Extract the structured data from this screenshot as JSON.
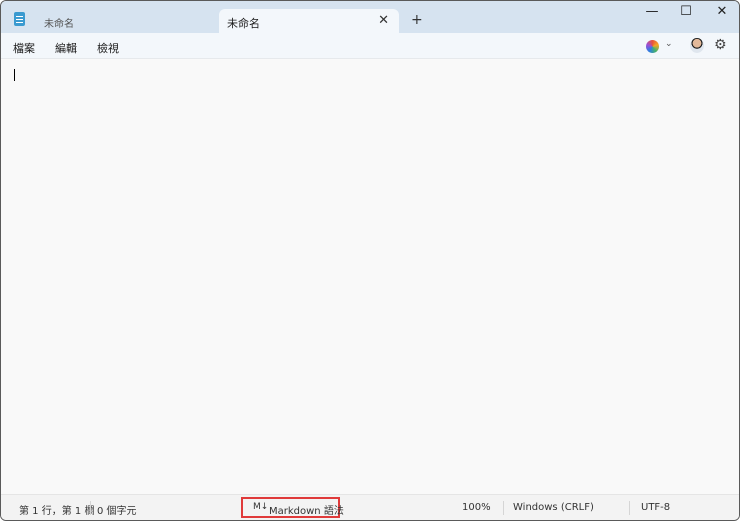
{
  "tabs": [
    {
      "label": "未命名",
      "active": false
    },
    {
      "label": "未命名",
      "active": true
    }
  ],
  "window_controls": {
    "minimize": "—",
    "maximize": "☐",
    "close": "✕"
  },
  "menu": [
    "檔案",
    "編輯",
    "檢視"
  ],
  "icons": {
    "app": "notepad-icon",
    "copilot": "copilot-icon",
    "avatar": "user-avatar",
    "settings": "gear-icon"
  },
  "status": {
    "position": "第 1 行，第 1 欄",
    "chars": "0 個字元",
    "markdown_icon": "M↓",
    "markdown": "Markdown 語法",
    "zoom": "100%",
    "line_ending": "Windows (CRLF)",
    "encoding": "UTF-8"
  },
  "highlight_color": "#e03a3a"
}
